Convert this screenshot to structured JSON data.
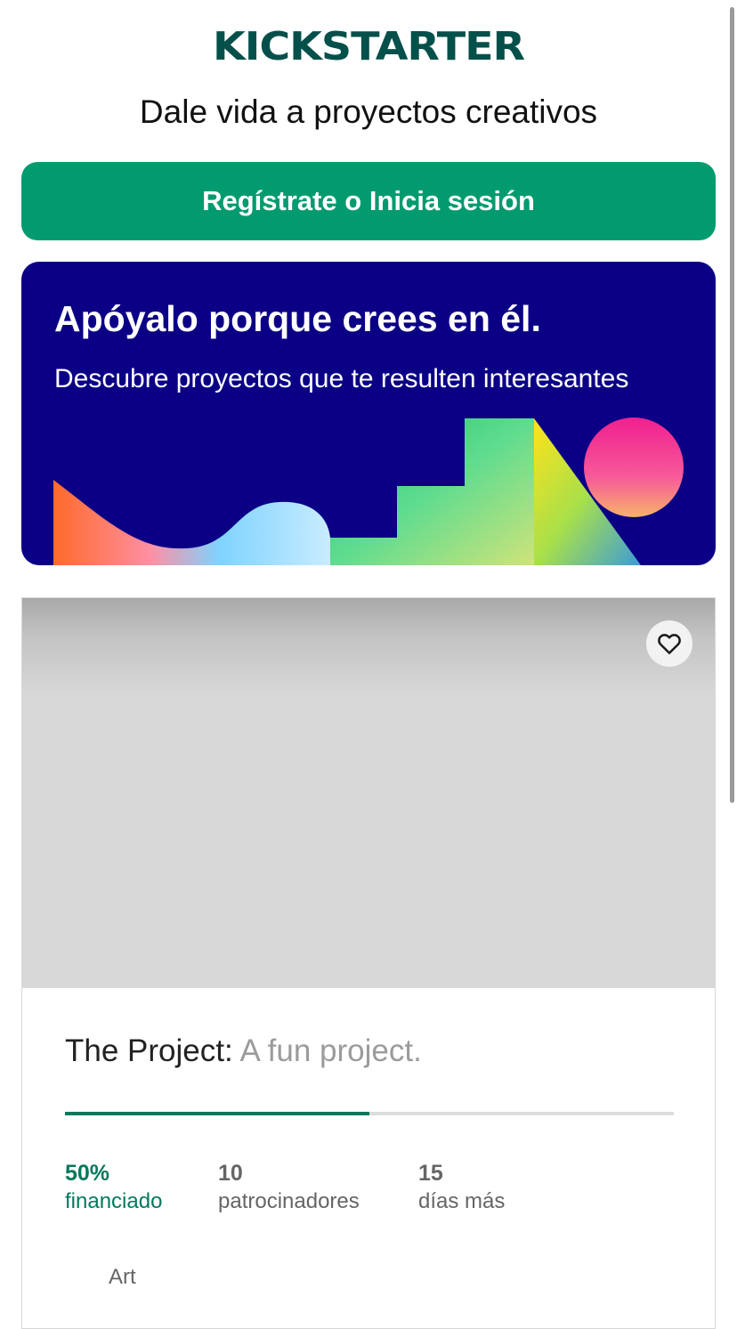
{
  "header": {
    "logo": "KICKSTARTER",
    "tagline": "Dale vida a proyectos creativos"
  },
  "auth_button": {
    "label": "Regístrate o Inicia sesión"
  },
  "promo": {
    "title": "Apóyalo porque crees en él.",
    "subtitle": "Descubre proyectos que te resulten interesantes"
  },
  "project": {
    "name": "The Project:",
    "blurb": "A fun project.",
    "funded_fraction": 0.5,
    "stats": [
      {
        "value": "50%",
        "label": "financiado"
      },
      {
        "value": "10",
        "label": "patrocinadores"
      },
      {
        "value": "15",
        "label": "días más"
      }
    ],
    "category": "Art",
    "favorite_icon": "heart-outline-icon"
  },
  "colors": {
    "brand_green": "#029b6f",
    "logo_green": "#05504a",
    "promo_blue": "#0b0085",
    "progress_green": "#05795d"
  }
}
